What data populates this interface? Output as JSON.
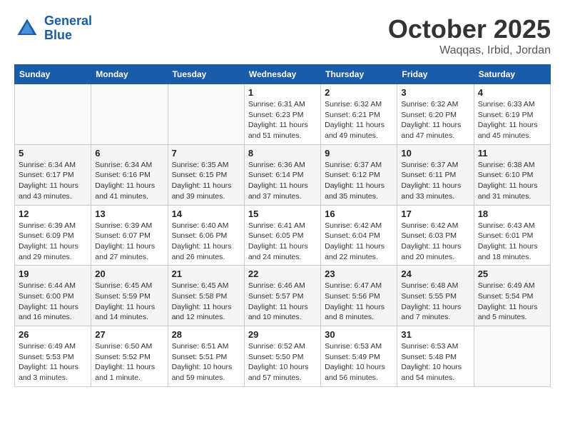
{
  "header": {
    "logo_line1": "General",
    "logo_line2": "Blue",
    "month": "October 2025",
    "location": "Waqqas, Irbid, Jordan"
  },
  "weekdays": [
    "Sunday",
    "Monday",
    "Tuesday",
    "Wednesday",
    "Thursday",
    "Friday",
    "Saturday"
  ],
  "weeks": [
    [
      {
        "day": "",
        "sunrise": "",
        "sunset": "",
        "daylight": ""
      },
      {
        "day": "",
        "sunrise": "",
        "sunset": "",
        "daylight": ""
      },
      {
        "day": "",
        "sunrise": "",
        "sunset": "",
        "daylight": ""
      },
      {
        "day": "1",
        "sunrise": "Sunrise: 6:31 AM",
        "sunset": "Sunset: 6:23 PM",
        "daylight": "Daylight: 11 hours and 51 minutes."
      },
      {
        "day": "2",
        "sunrise": "Sunrise: 6:32 AM",
        "sunset": "Sunset: 6:21 PM",
        "daylight": "Daylight: 11 hours and 49 minutes."
      },
      {
        "day": "3",
        "sunrise": "Sunrise: 6:32 AM",
        "sunset": "Sunset: 6:20 PM",
        "daylight": "Daylight: 11 hours and 47 minutes."
      },
      {
        "day": "4",
        "sunrise": "Sunrise: 6:33 AM",
        "sunset": "Sunset: 6:19 PM",
        "daylight": "Daylight: 11 hours and 45 minutes."
      }
    ],
    [
      {
        "day": "5",
        "sunrise": "Sunrise: 6:34 AM",
        "sunset": "Sunset: 6:17 PM",
        "daylight": "Daylight: 11 hours and 43 minutes."
      },
      {
        "day": "6",
        "sunrise": "Sunrise: 6:34 AM",
        "sunset": "Sunset: 6:16 PM",
        "daylight": "Daylight: 11 hours and 41 minutes."
      },
      {
        "day": "7",
        "sunrise": "Sunrise: 6:35 AM",
        "sunset": "Sunset: 6:15 PM",
        "daylight": "Daylight: 11 hours and 39 minutes."
      },
      {
        "day": "8",
        "sunrise": "Sunrise: 6:36 AM",
        "sunset": "Sunset: 6:14 PM",
        "daylight": "Daylight: 11 hours and 37 minutes."
      },
      {
        "day": "9",
        "sunrise": "Sunrise: 6:37 AM",
        "sunset": "Sunset: 6:12 PM",
        "daylight": "Daylight: 11 hours and 35 minutes."
      },
      {
        "day": "10",
        "sunrise": "Sunrise: 6:37 AM",
        "sunset": "Sunset: 6:11 PM",
        "daylight": "Daylight: 11 hours and 33 minutes."
      },
      {
        "day": "11",
        "sunrise": "Sunrise: 6:38 AM",
        "sunset": "Sunset: 6:10 PM",
        "daylight": "Daylight: 11 hours and 31 minutes."
      }
    ],
    [
      {
        "day": "12",
        "sunrise": "Sunrise: 6:39 AM",
        "sunset": "Sunset: 6:09 PM",
        "daylight": "Daylight: 11 hours and 29 minutes."
      },
      {
        "day": "13",
        "sunrise": "Sunrise: 6:39 AM",
        "sunset": "Sunset: 6:07 PM",
        "daylight": "Daylight: 11 hours and 27 minutes."
      },
      {
        "day": "14",
        "sunrise": "Sunrise: 6:40 AM",
        "sunset": "Sunset: 6:06 PM",
        "daylight": "Daylight: 11 hours and 26 minutes."
      },
      {
        "day": "15",
        "sunrise": "Sunrise: 6:41 AM",
        "sunset": "Sunset: 6:05 PM",
        "daylight": "Daylight: 11 hours and 24 minutes."
      },
      {
        "day": "16",
        "sunrise": "Sunrise: 6:42 AM",
        "sunset": "Sunset: 6:04 PM",
        "daylight": "Daylight: 11 hours and 22 minutes."
      },
      {
        "day": "17",
        "sunrise": "Sunrise: 6:42 AM",
        "sunset": "Sunset: 6:03 PM",
        "daylight": "Daylight: 11 hours and 20 minutes."
      },
      {
        "day": "18",
        "sunrise": "Sunrise: 6:43 AM",
        "sunset": "Sunset: 6:01 PM",
        "daylight": "Daylight: 11 hours and 18 minutes."
      }
    ],
    [
      {
        "day": "19",
        "sunrise": "Sunrise: 6:44 AM",
        "sunset": "Sunset: 6:00 PM",
        "daylight": "Daylight: 11 hours and 16 minutes."
      },
      {
        "day": "20",
        "sunrise": "Sunrise: 6:45 AM",
        "sunset": "Sunset: 5:59 PM",
        "daylight": "Daylight: 11 hours and 14 minutes."
      },
      {
        "day": "21",
        "sunrise": "Sunrise: 6:45 AM",
        "sunset": "Sunset: 5:58 PM",
        "daylight": "Daylight: 11 hours and 12 minutes."
      },
      {
        "day": "22",
        "sunrise": "Sunrise: 6:46 AM",
        "sunset": "Sunset: 5:57 PM",
        "daylight": "Daylight: 11 hours and 10 minutes."
      },
      {
        "day": "23",
        "sunrise": "Sunrise: 6:47 AM",
        "sunset": "Sunset: 5:56 PM",
        "daylight": "Daylight: 11 hours and 8 minutes."
      },
      {
        "day": "24",
        "sunrise": "Sunrise: 6:48 AM",
        "sunset": "Sunset: 5:55 PM",
        "daylight": "Daylight: 11 hours and 7 minutes."
      },
      {
        "day": "25",
        "sunrise": "Sunrise: 6:49 AM",
        "sunset": "Sunset: 5:54 PM",
        "daylight": "Daylight: 11 hours and 5 minutes."
      }
    ],
    [
      {
        "day": "26",
        "sunrise": "Sunrise: 6:49 AM",
        "sunset": "Sunset: 5:53 PM",
        "daylight": "Daylight: 11 hours and 3 minutes."
      },
      {
        "day": "27",
        "sunrise": "Sunrise: 6:50 AM",
        "sunset": "Sunset: 5:52 PM",
        "daylight": "Daylight: 11 hours and 1 minute."
      },
      {
        "day": "28",
        "sunrise": "Sunrise: 6:51 AM",
        "sunset": "Sunset: 5:51 PM",
        "daylight": "Daylight: 10 hours and 59 minutes."
      },
      {
        "day": "29",
        "sunrise": "Sunrise: 6:52 AM",
        "sunset": "Sunset: 5:50 PM",
        "daylight": "Daylight: 10 hours and 57 minutes."
      },
      {
        "day": "30",
        "sunrise": "Sunrise: 6:53 AM",
        "sunset": "Sunset: 5:49 PM",
        "daylight": "Daylight: 10 hours and 56 minutes."
      },
      {
        "day": "31",
        "sunrise": "Sunrise: 6:53 AM",
        "sunset": "Sunset: 5:48 PM",
        "daylight": "Daylight: 10 hours and 54 minutes."
      },
      {
        "day": "",
        "sunrise": "",
        "sunset": "",
        "daylight": ""
      }
    ]
  ]
}
